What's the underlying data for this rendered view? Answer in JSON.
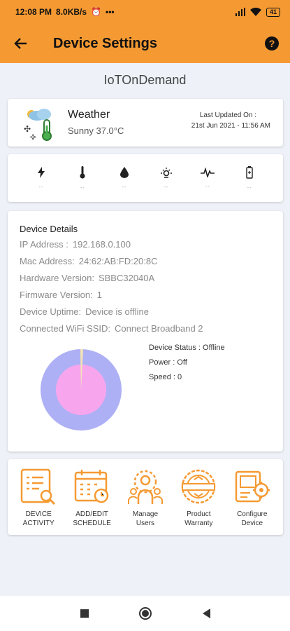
{
  "status_bar": {
    "time": "12:08 PM",
    "speed": "8.0KB/s",
    "dots": "•••",
    "battery": "41"
  },
  "app_bar": {
    "title": "Device Settings",
    "help": "?"
  },
  "device_name": "IoTOnDemand",
  "weather": {
    "title": "Weather",
    "value": "Sunny 37.0°C",
    "updated_label": "Last Updated On :",
    "updated_value": "21st Jun 2021 - 11:56 AM"
  },
  "sensors": [
    {
      "icon": "lightning-icon",
      "value": "--"
    },
    {
      "icon": "thermometer-icon",
      "value": "--"
    },
    {
      "icon": "humidity-drop-icon",
      "value": "--"
    },
    {
      "icon": "light-sensor-icon",
      "value": "--"
    },
    {
      "icon": "pulse-icon",
      "value": "--"
    },
    {
      "icon": "battery-icon",
      "value": "--"
    }
  ],
  "details": {
    "title": "Device Details",
    "ip_label": "IP Address :",
    "ip_value": "192.168.0.100",
    "mac_label": "Mac Address:",
    "mac_value": "24:62:AB:FD:20:8C",
    "hw_label": "Hardware Version:",
    "hw_value": "SBBC32040A",
    "fw_label": "Firmware Version:",
    "fw_value": "1",
    "uptime_label": "Device Uptime:",
    "uptime_value": "Device is offline",
    "ssid_label": "Connected WiFi SSID:",
    "ssid_value": "Connect Broadband 2",
    "status": "Device Status : Offline",
    "power": "Power : Off",
    "speed": "Speed : 0"
  },
  "actions": [
    {
      "label": "DEVICE\nACTIVITY",
      "icon": "activity-log-icon"
    },
    {
      "label": "ADD/EDIT\nSCHEDULE",
      "icon": "calendar-schedule-icon"
    },
    {
      "label": "Manage\nUsers",
      "icon": "users-gear-icon"
    },
    {
      "label": "Product\nWarranty",
      "icon": "warranty-badge-icon"
    },
    {
      "label": "Configure\nDevice",
      "icon": "configure-device-icon"
    }
  ],
  "colors": {
    "accent": "#f59a33",
    "pie_outer": "#aeb0f5",
    "pie_inner": "#f7a6ee"
  }
}
